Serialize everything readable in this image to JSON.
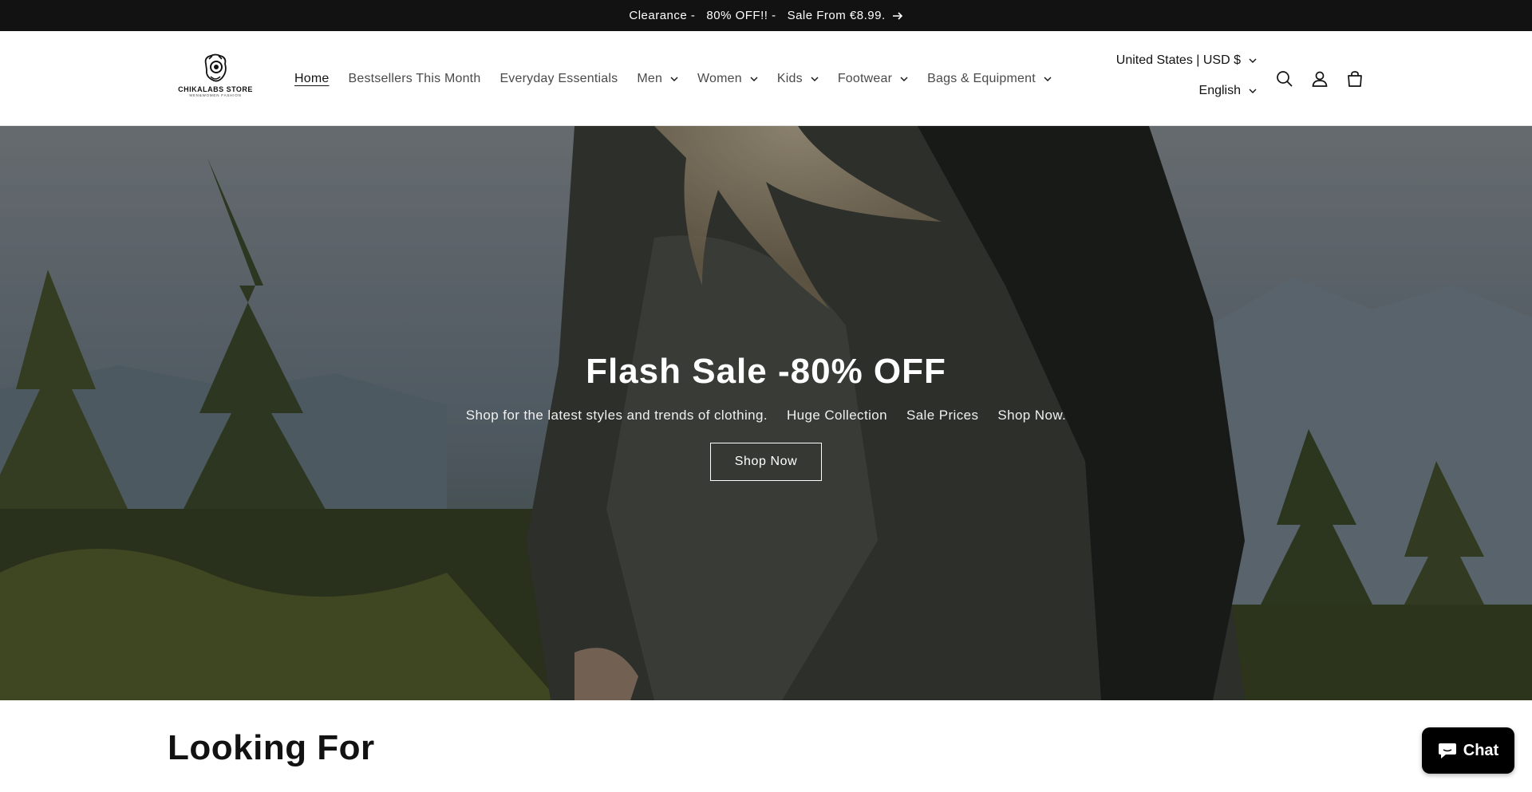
{
  "announcement": {
    "text": "Clearance -   80% OFF!! -   Sale From €8.99.",
    "icon": "arrow-right-icon"
  },
  "logo": {
    "name": "CHIKALABS STORE",
    "tagline": "MEN&WOMEN FASHION"
  },
  "nav": {
    "items": [
      {
        "label": "Home",
        "active": true,
        "dropdown": false
      },
      {
        "label": "Bestsellers This Month",
        "active": false,
        "dropdown": false
      },
      {
        "label": "Everyday Essentials",
        "active": false,
        "dropdown": false
      },
      {
        "label": "Men",
        "active": false,
        "dropdown": true
      },
      {
        "label": "Women",
        "active": false,
        "dropdown": true
      },
      {
        "label": "Kids",
        "active": false,
        "dropdown": true
      },
      {
        "label": "Footwear",
        "active": false,
        "dropdown": true
      },
      {
        "label": "Bags & Equipment",
        "active": false,
        "dropdown": true
      }
    ]
  },
  "locale": {
    "country": "United States | USD $",
    "language": "English"
  },
  "header_icons": [
    "search-icon",
    "account-icon",
    "cart-icon"
  ],
  "hero": {
    "title": "Flash Sale -80% OFF",
    "subtitle_parts": [
      "Shop for the latest styles and trends of clothing.",
      "Huge Collection",
      "Sale Prices",
      "Shop Now."
    ],
    "button_label": "Shop Now"
  },
  "section": {
    "title": "Looking For"
  },
  "chat": {
    "label": "Chat",
    "icon": "chat-bubble-icon"
  },
  "colors": {
    "announcement_bg": "#121212",
    "text": "#121212",
    "nav_text": "#4a4a4a",
    "chat_bg": "#000000"
  }
}
